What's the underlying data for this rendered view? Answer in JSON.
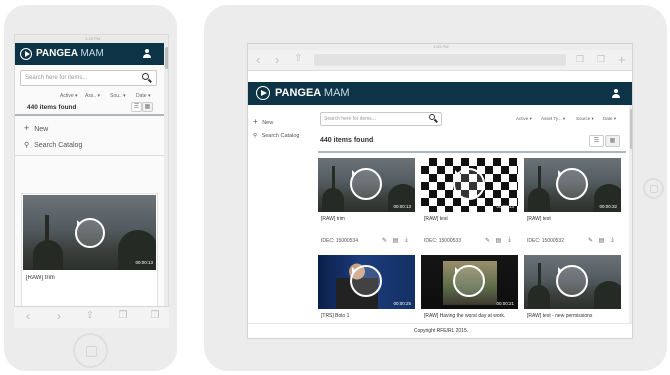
{
  "phone": {
    "status_time": "1:43 PM",
    "brand": "PANGEA",
    "brand_suffix": "MAM",
    "search_placeholder": "Search here for items...",
    "filters": [
      "Active ▾",
      "Ass.. ▾",
      "Sou.. ▾",
      "Date ▾"
    ],
    "items_found": "440 items found",
    "new_label": "New",
    "search_catalog_label": "Search Catalog",
    "card": {
      "title": "[RAW] trim",
      "duration": "00:00:13"
    }
  },
  "tablet": {
    "status_time": "1:43 PM",
    "brand": "PANGEA",
    "brand_suffix": "MAM",
    "sidebar": {
      "new_label": "New",
      "search_catalog_label": "Search Catalog"
    },
    "search_placeholder": "Search here for items...",
    "filters": [
      "Active ▾",
      "Asset Ty... ▾",
      "Source ▾",
      "Date ▾"
    ],
    "items_found": "440 items found",
    "cards": [
      {
        "title": "[RAW] trim",
        "id": "IDEC: 15000534",
        "duration": "00:00:13",
        "thumb": "forest"
      },
      {
        "title": "[RAW] test",
        "id": "IDEC: 15000533",
        "duration": "00:00:13",
        "thumb": "checker"
      },
      {
        "title": "[RAW] test",
        "id": "IDEC: 15000532",
        "duration": "00:00:32",
        "thumb": "forest"
      },
      {
        "title": "[TRS] Bolo 1",
        "id": "",
        "duration": "00:00:25",
        "thumb": "news"
      },
      {
        "title": "[RAW] Having the worst day at work.",
        "id": "",
        "duration": "00:00:21",
        "thumb": "dark"
      },
      {
        "title": "[RAW] test - new permissions",
        "id": "",
        "duration": "",
        "thumb": "forest"
      }
    ],
    "footer": "Copyright RFE/RL 2015."
  },
  "colors": {
    "header_bg": "#0d3446",
    "device_frame": "#ececec",
    "accent": "#ffffff"
  },
  "icons": [
    "user-icon",
    "search-icon",
    "plus-icon",
    "play-icon",
    "edit-icon",
    "delete-icon",
    "download-icon",
    "list-view-icon",
    "grid-view-icon",
    "back-icon",
    "forward-icon",
    "share-icon",
    "bookmark-icon",
    "tabs-icon"
  ]
}
